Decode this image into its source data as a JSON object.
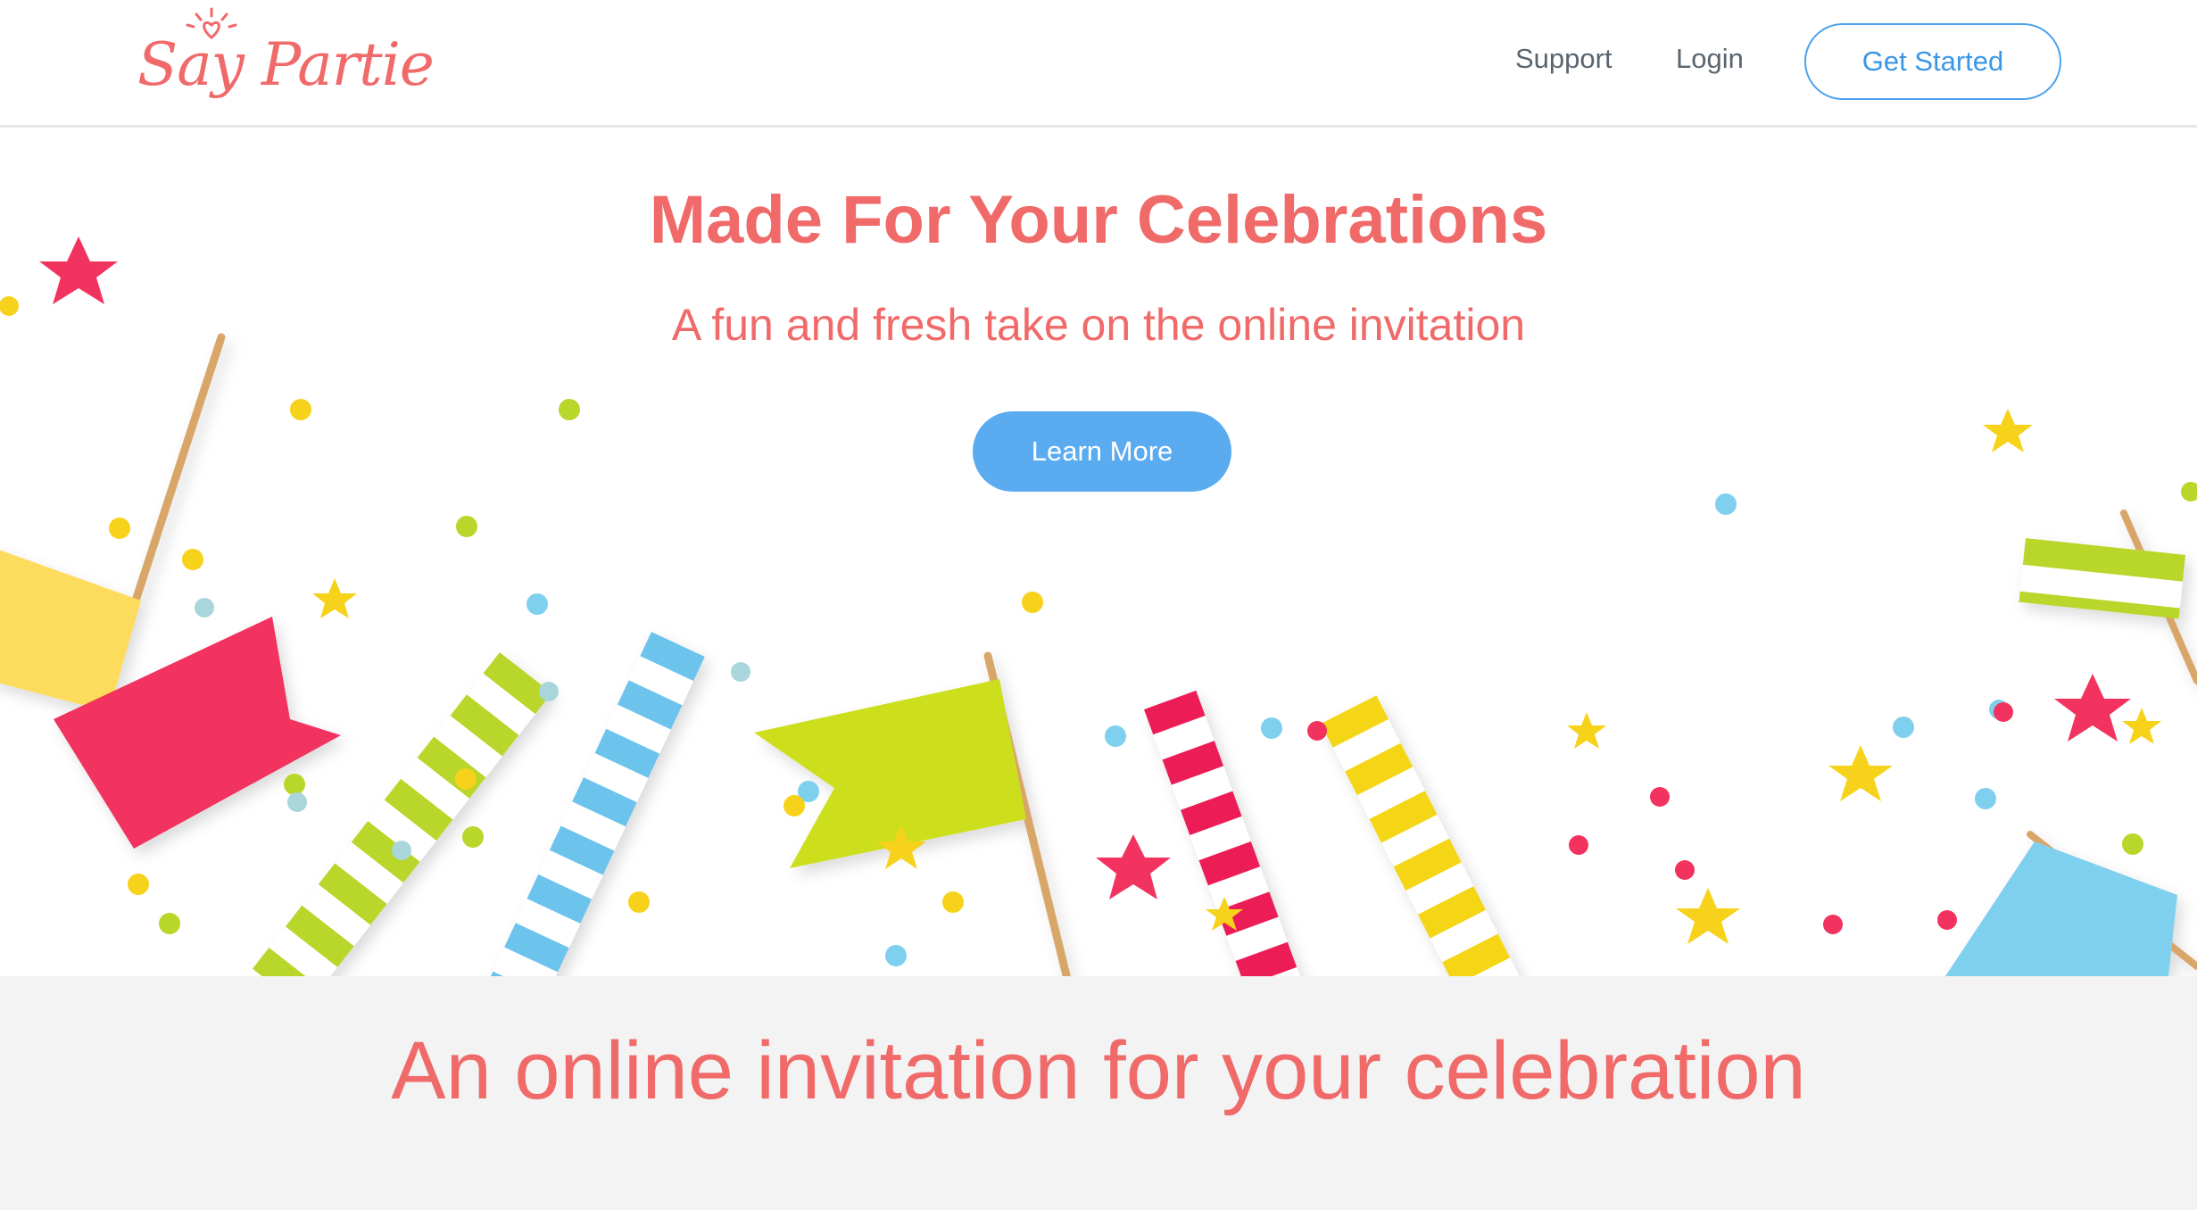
{
  "header": {
    "logo_text": "Say Partie",
    "nav": {
      "support": "Support",
      "login": "Login",
      "get_started": "Get Started"
    }
  },
  "hero": {
    "title": "Made For Your Celebrations",
    "subtitle": "A fun and fresh take on the online invitation",
    "cta": "Learn More",
    "decoration": [
      "flag-icon",
      "striped-straw-icon",
      "star-icon",
      "confetti-dot-icon"
    ]
  },
  "section2": {
    "title": "An online invitation for your celebration"
  },
  "colors": {
    "brand": "#f06a6a",
    "accent_blue": "#5aabf0",
    "nav_text": "#5a6570",
    "section_bg": "#f3f3f3",
    "pink": "#f2335f",
    "lime": "#c8dc1f",
    "yellow": "#f7d21a",
    "light_blue": "#7fd0ee"
  }
}
